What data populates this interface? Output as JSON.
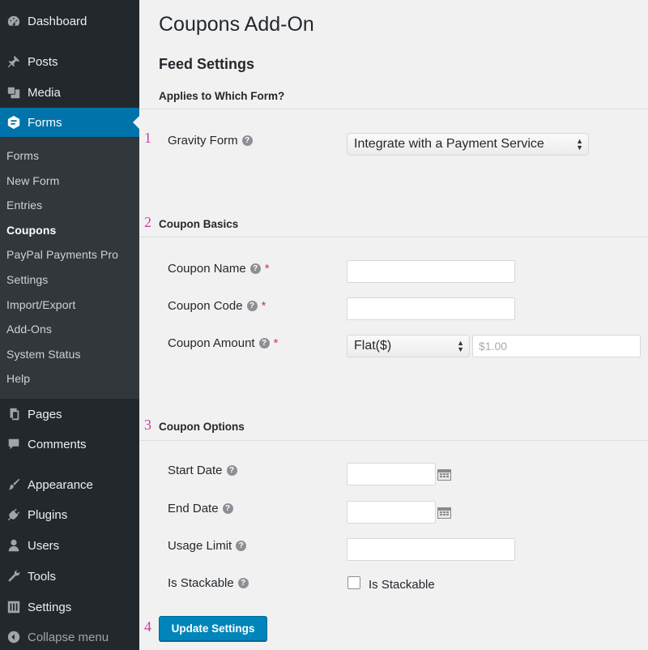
{
  "sidebar": {
    "items": [
      {
        "label": "Dashboard",
        "icon": "dashboard-icon"
      },
      {
        "label": "Posts",
        "icon": "pin-icon"
      },
      {
        "label": "Media",
        "icon": "media-icon"
      },
      {
        "label": "Forms",
        "icon": "forms-icon"
      },
      {
        "label": "Pages",
        "icon": "pages-icon"
      },
      {
        "label": "Comments",
        "icon": "comment-icon"
      },
      {
        "label": "Appearance",
        "icon": "paintbrush-icon"
      },
      {
        "label": "Plugins",
        "icon": "plug-icon"
      },
      {
        "label": "Users",
        "icon": "user-icon"
      },
      {
        "label": "Tools",
        "icon": "wrench-icon"
      },
      {
        "label": "Settings",
        "icon": "sliders-icon"
      },
      {
        "label": "Collapse menu",
        "icon": "collapse-icon"
      }
    ],
    "submenu": [
      "Forms",
      "New Form",
      "Entries",
      "Coupons",
      "PayPal Payments Pro",
      "Settings",
      "Import/Export",
      "Add-Ons",
      "System Status",
      "Help"
    ],
    "accent": "#0073aa"
  },
  "main": {
    "title": "Coupons Add-On",
    "feed_settings": "Feed Settings",
    "sections": {
      "applies": "Applies to Which Form?",
      "basics": "Coupon Basics",
      "options": "Coupon Options"
    },
    "steps": [
      "1",
      "2",
      "3",
      "4"
    ],
    "fields": {
      "gravity_form": {
        "label": "Gravity Form",
        "value": "Integrate with a Payment Service"
      },
      "coupon_name": {
        "label": "Coupon Name",
        "value": ""
      },
      "coupon_code": {
        "label": "Coupon Code",
        "value": ""
      },
      "coupon_amount": {
        "label": "Coupon Amount",
        "type_value": "Flat($)",
        "placeholder": "$1.00"
      },
      "start_date": {
        "label": "Start Date",
        "value": ""
      },
      "end_date": {
        "label": "End Date",
        "value": ""
      },
      "usage_limit": {
        "label": "Usage Limit",
        "value": ""
      },
      "is_stackable": {
        "label": "Is Stackable",
        "checkbox_label": "Is Stackable",
        "checked": false
      }
    },
    "required_mark": "*",
    "help_mark": "?",
    "update_button": "Update Settings",
    "button_color": "#0085ba",
    "step_color": "#d43aa3"
  }
}
